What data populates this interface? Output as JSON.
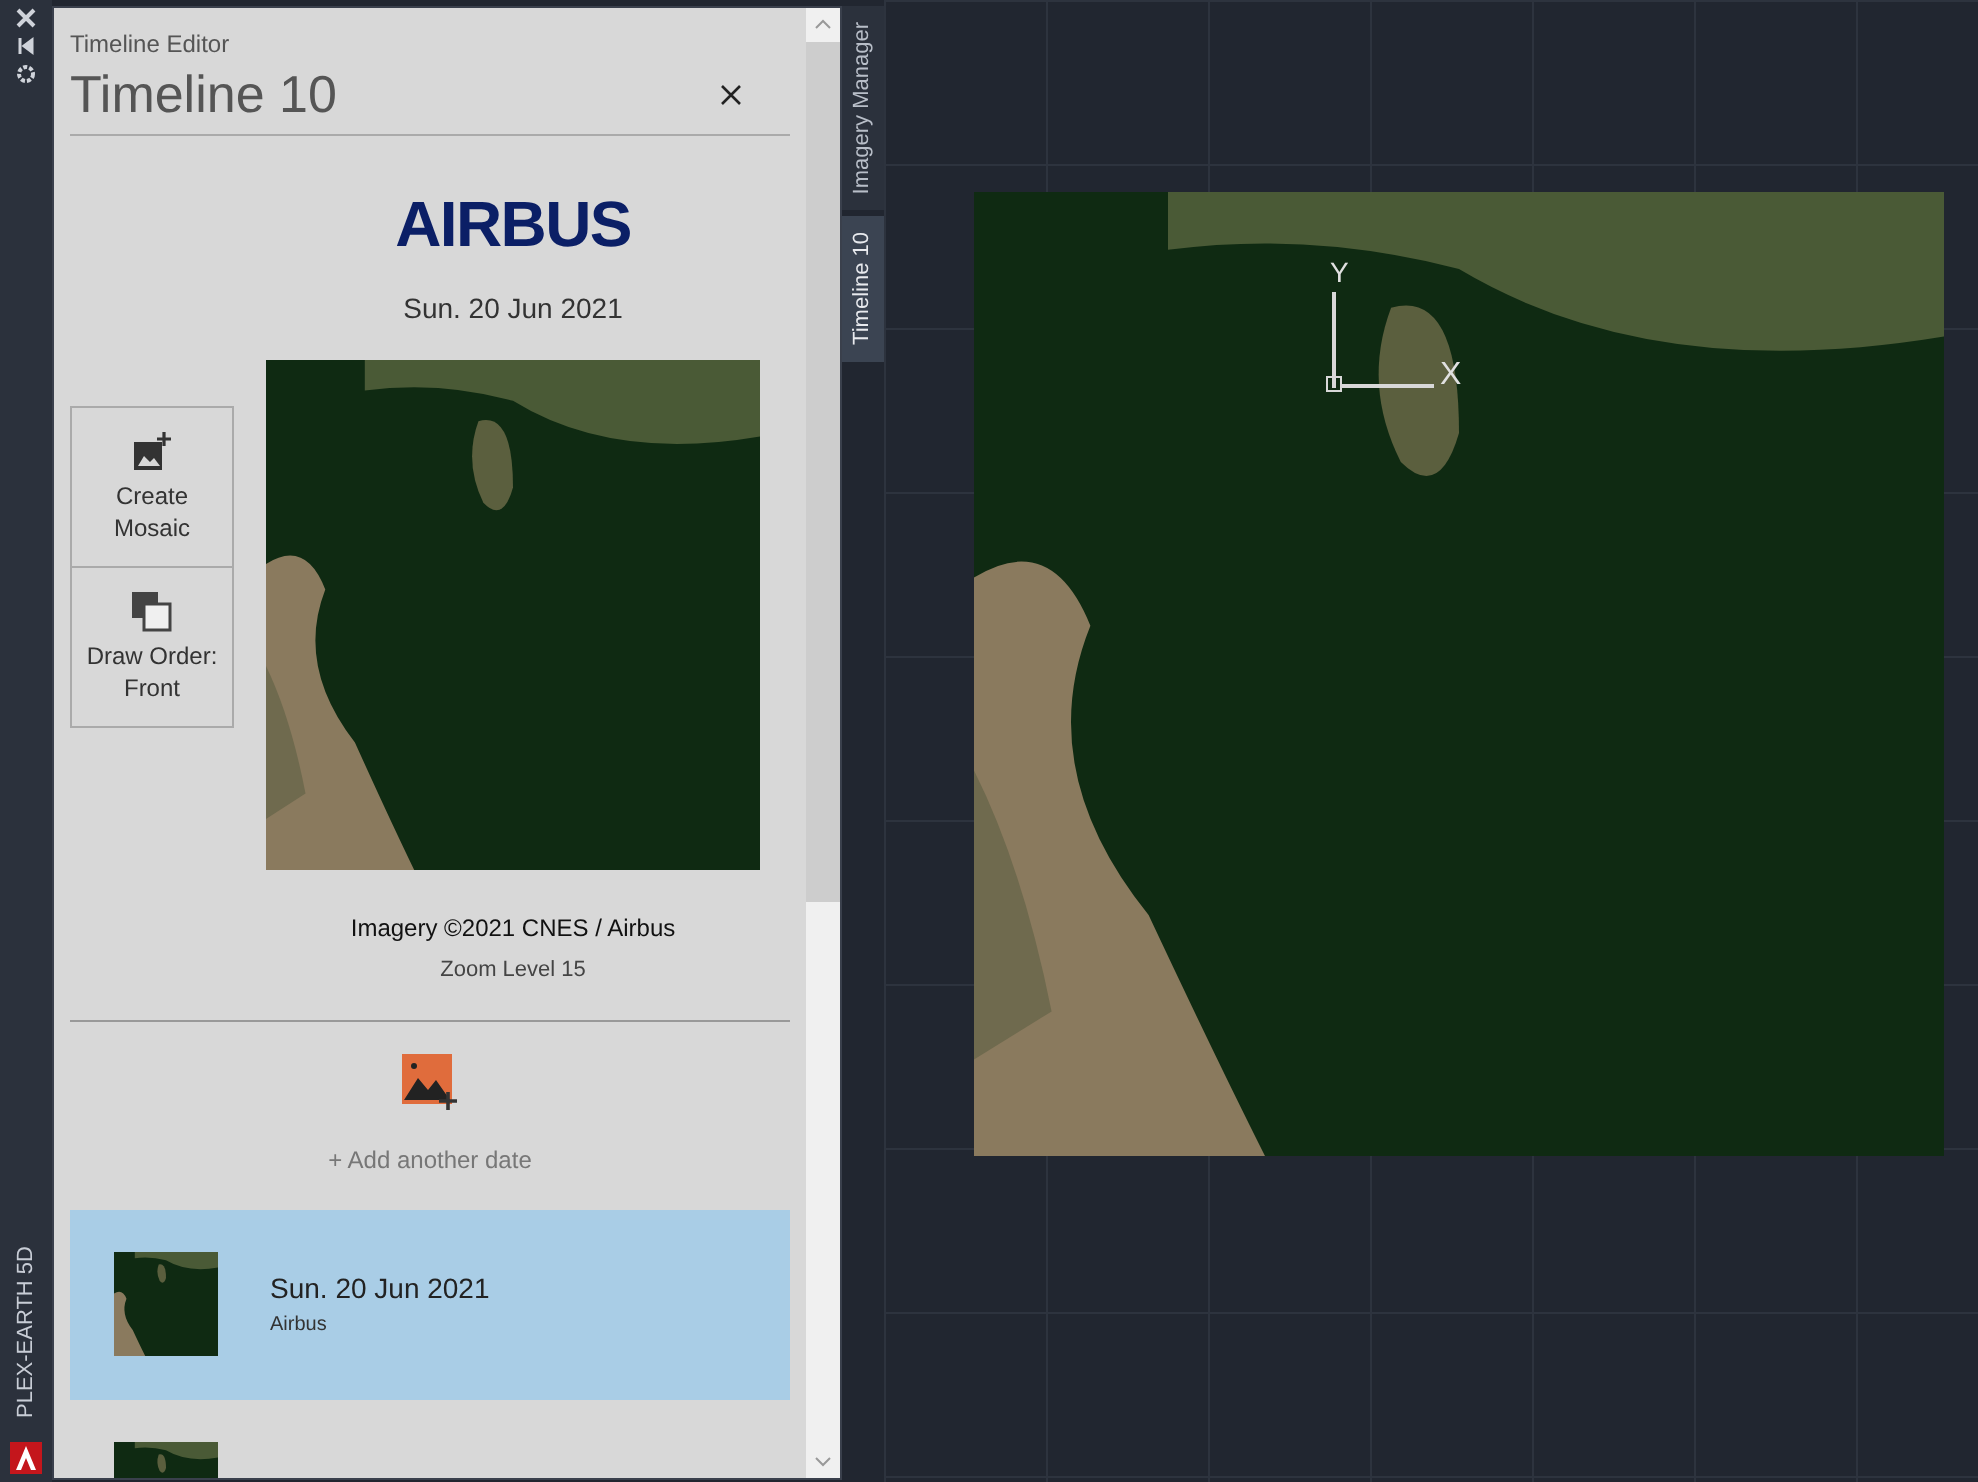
{
  "app_strip": {
    "label": "PLEX-EARTH 5D"
  },
  "panel": {
    "subtitle": "Timeline Editor",
    "title": "Timeline 10",
    "provider_logo": "AIRBUS",
    "date": "Sun. 20 Jun 2021",
    "actions": [
      {
        "label": "Create Mosaic",
        "kind": "mosaic"
      },
      {
        "label": "Draw Order: Front",
        "kind": "order"
      }
    ],
    "credit": "Imagery ©2021 CNES / Airbus",
    "zoom_level": "Zoom Level 15",
    "add_date": "+ Add another date",
    "entries": [
      {
        "date": "Sun. 20 Jun 2021",
        "provider": "Airbus",
        "selected": true
      },
      {
        "selected": false
      }
    ]
  },
  "side_tabs": [
    {
      "label": "Imagery Manager",
      "selected": false
    },
    {
      "label": "Timeline 10",
      "selected": true
    }
  ],
  "canvas": {
    "ucs_axes": [
      "Y",
      "X"
    ]
  }
}
